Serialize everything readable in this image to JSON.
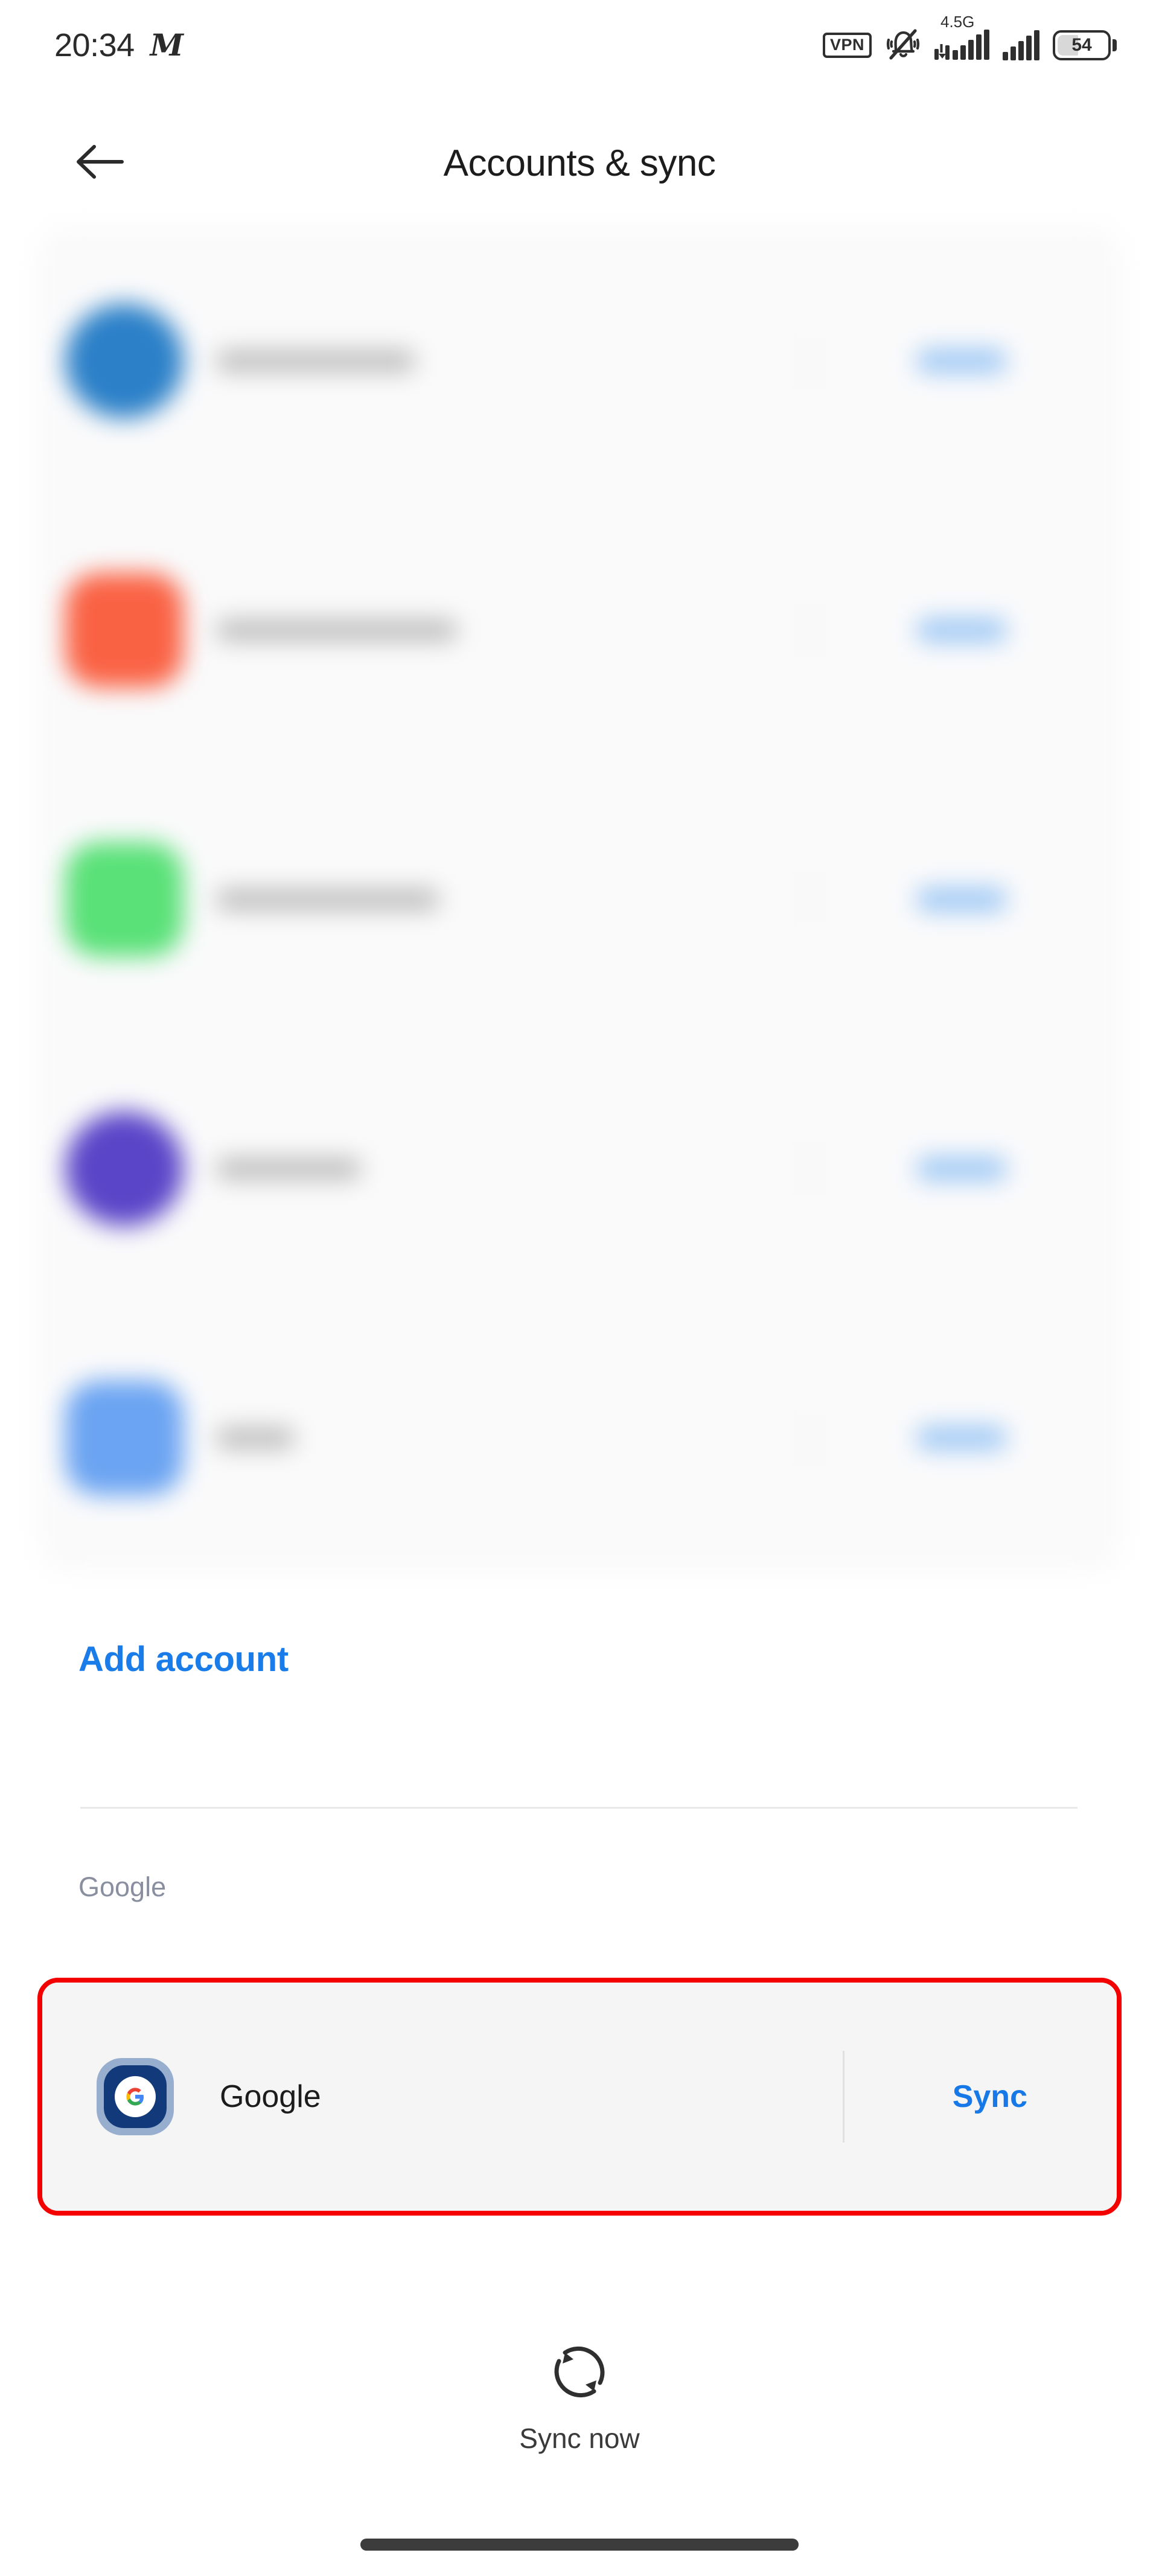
{
  "status_bar": {
    "clock": "20:34",
    "brand_glyph": "M",
    "vpn_label": "VPN",
    "network_label": "4.5G",
    "battery_level": "54",
    "icons": [
      "vpn-badge",
      "silent-bell-icon",
      "signal-bars-icon",
      "signal-bars-secondary-icon",
      "battery-icon"
    ]
  },
  "header": {
    "back_icon": "back-arrow-icon",
    "title": "Accounts & sync"
  },
  "accounts": {
    "redacted": true,
    "rows": [
      {
        "icon_color": "#2b80c8",
        "name_width": 330,
        "shape": "circle"
      },
      {
        "icon_color": "#fa6244",
        "name_width": 400,
        "shape": "rounded"
      },
      {
        "icon_color": "#5ae178",
        "name_width": 370,
        "shape": "rounded"
      },
      {
        "icon_color": "#5a45c8",
        "name_width": 240,
        "shape": "circle"
      },
      {
        "icon_color": "#6ba4f2",
        "name_width": 130,
        "shape": "rounded"
      }
    ],
    "action_label": "Sync"
  },
  "add_account": {
    "label": "Add account",
    "color": "#1a7ce8"
  },
  "google_section": {
    "label": "Google",
    "card": {
      "icon": "google-g-icon",
      "name": "Google",
      "action_label": "Sync",
      "action_color": "#1779e8"
    },
    "highlight_color": "#f40000"
  },
  "footer": {
    "sync_icon": "sync-refresh-icon",
    "label": "Sync now"
  }
}
